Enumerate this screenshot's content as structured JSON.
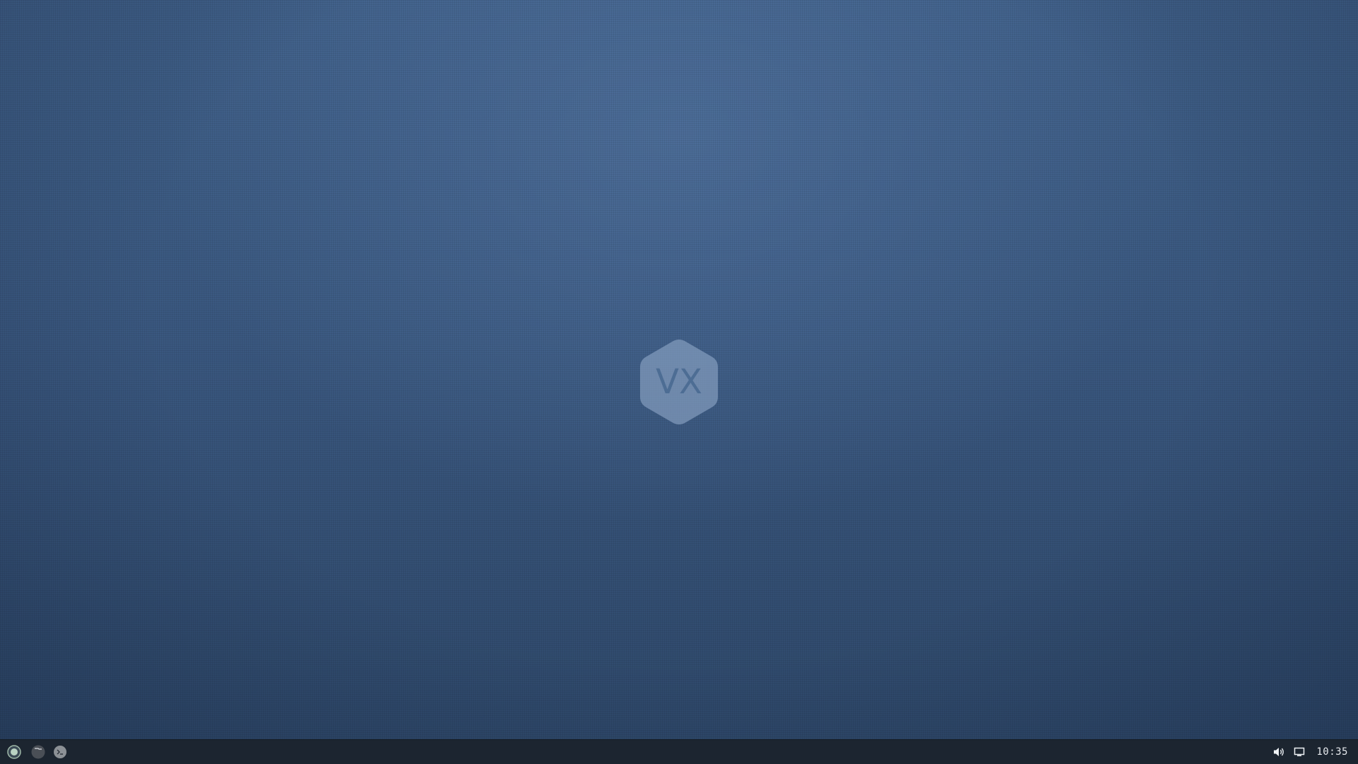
{
  "desktop": {
    "logo_text": "VX",
    "background_color": "#3a5880"
  },
  "taskbar": {
    "background_color": "#1c2530",
    "launchers": [
      {
        "icon": "start-menu-icon"
      },
      {
        "icon": "file-manager-icon"
      },
      {
        "icon": "terminal-icon"
      }
    ],
    "tray": {
      "volume_icon": "volume-icon",
      "display_icon": "display-icon",
      "clock": "10:35"
    }
  }
}
